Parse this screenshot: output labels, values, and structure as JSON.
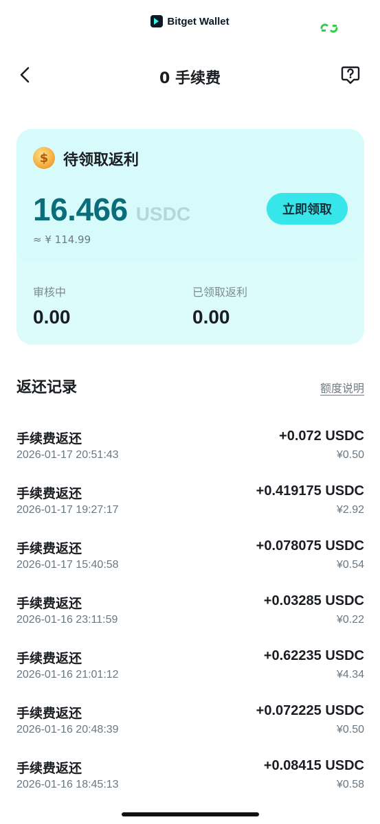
{
  "brand": {
    "name": "Bitget Wallet",
    "logo_icon": "bitget-logo-icon"
  },
  "status": {
    "sync_icon": "sync-icon",
    "sync_color": "#2fcf4a"
  },
  "nav": {
    "title": "0 手续费",
    "back_icon": "chevron-left-icon",
    "help_icon": "help-icon"
  },
  "rebate": {
    "label": "待领取返利",
    "coin_icon": "coin-icon",
    "coin_glyph": "$",
    "amount": "16.466",
    "unit": "USDC",
    "approx": "≈ ¥ 114.99",
    "claim_label": "立即领取",
    "accent": "#36e6ea"
  },
  "stats": {
    "reviewing_label": "审核中",
    "reviewing_value": "0.00",
    "claimed_label": "已领取返利",
    "claimed_value": "0.00"
  },
  "records": {
    "title": "返还记录",
    "quota_link": "额度说明",
    "items": [
      {
        "title": "手续费返还",
        "time": "2026-01-17 20:51:43",
        "amount": "+0.072 USDC",
        "cny": "¥0.50"
      },
      {
        "title": "手续费返还",
        "time": "2026-01-17 19:27:17",
        "amount": "+0.419175 USDC",
        "cny": "¥2.92"
      },
      {
        "title": "手续费返还",
        "time": "2026-01-17 15:40:58",
        "amount": "+0.078075 USDC",
        "cny": "¥0.54"
      },
      {
        "title": "手续费返还",
        "time": "2026-01-16 23:11:59",
        "amount": "+0.03285 USDC",
        "cny": "¥0.22"
      },
      {
        "title": "手续费返还",
        "time": "2026-01-16 21:01:12",
        "amount": "+0.62235 USDC",
        "cny": "¥4.34"
      },
      {
        "title": "手续费返还",
        "time": "2026-01-16 20:48:39",
        "amount": "+0.072225 USDC",
        "cny": "¥0.50"
      },
      {
        "title": "手续费返还",
        "time": "2026-01-16 18:45:13",
        "amount": "+0.08415 USDC",
        "cny": "¥0.58"
      }
    ]
  }
}
